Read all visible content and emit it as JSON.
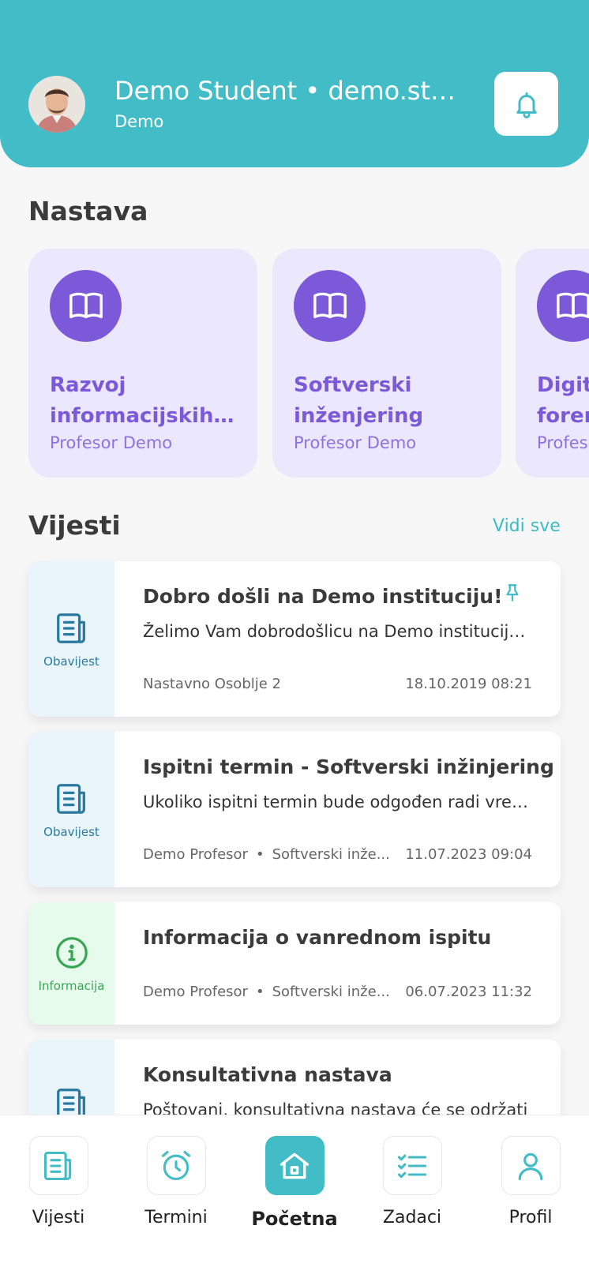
{
  "header": {
    "user_name": "Demo Student  •  demo.student@demo",
    "user_sub": "Demo",
    "bell_icon": "bell-icon"
  },
  "colors": {
    "primary": "#42bcc6",
    "course_accent": "#7b59d9",
    "course_bg": "#ebe8fd",
    "notice_bg": "#eaf4fb",
    "info_bg": "#e6fbec"
  },
  "courses_section": {
    "title": "Nastava",
    "items": [
      {
        "title_line1": "Razvoj",
        "title_line2": "informacijskih sistema",
        "professor": "Profesor Demo",
        "icon": "book-icon"
      },
      {
        "title_line1": "Softverski",
        "title_line2": "inženjering",
        "professor": "Profesor Demo",
        "icon": "book-icon"
      },
      {
        "title_line1": "Digitalna",
        "title_line2": "forenzika",
        "professor": "Profesor Demo",
        "icon": "book-icon"
      }
    ]
  },
  "news_section": {
    "title": "Vijesti",
    "see_all": "Vidi sve",
    "items": [
      {
        "type": "Obavijest",
        "title": "Dobro došli na Demo instituciju!",
        "snippet": "Želimo Vam dobrodošlicu na Demo instituciju i puno uspjeha",
        "author": "Nastavno Osoblje 2",
        "course": "",
        "date": "18.10.2019 08:21",
        "pinned": true
      },
      {
        "type": "Obavijest",
        "title": "Ispitni termin - Softverski inžinjering",
        "snippet": "Ukoliko ispitni termin bude odgođen radi vremenskih uslova",
        "author": "Demo Profesor",
        "course": "Softverski inže...",
        "date": "11.07.2023 09:04",
        "pinned": false
      },
      {
        "type": "Informacija",
        "title": "Informacija o vanrednom ispitu",
        "snippet": "",
        "author": "Demo Profesor",
        "course": "Softverski inže...",
        "date": "06.07.2023 11:32",
        "pinned": false
      },
      {
        "type": "Obavijest",
        "title": "Konsultativna nastava",
        "snippet": "Poštovani, konsultativna nastava će se održati",
        "author": "",
        "course": "",
        "date": "",
        "pinned": false
      }
    ]
  },
  "bottom_nav": [
    {
      "label": "Vijesti",
      "icon": "newspaper-icon",
      "active": false
    },
    {
      "label": "Termini",
      "icon": "alarm-clock-icon",
      "active": false
    },
    {
      "label": "Početna",
      "icon": "home-icon",
      "active": true
    },
    {
      "label": "Zadaci",
      "icon": "checklist-icon",
      "active": false
    },
    {
      "label": "Profil",
      "icon": "user-icon",
      "active": false
    }
  ]
}
